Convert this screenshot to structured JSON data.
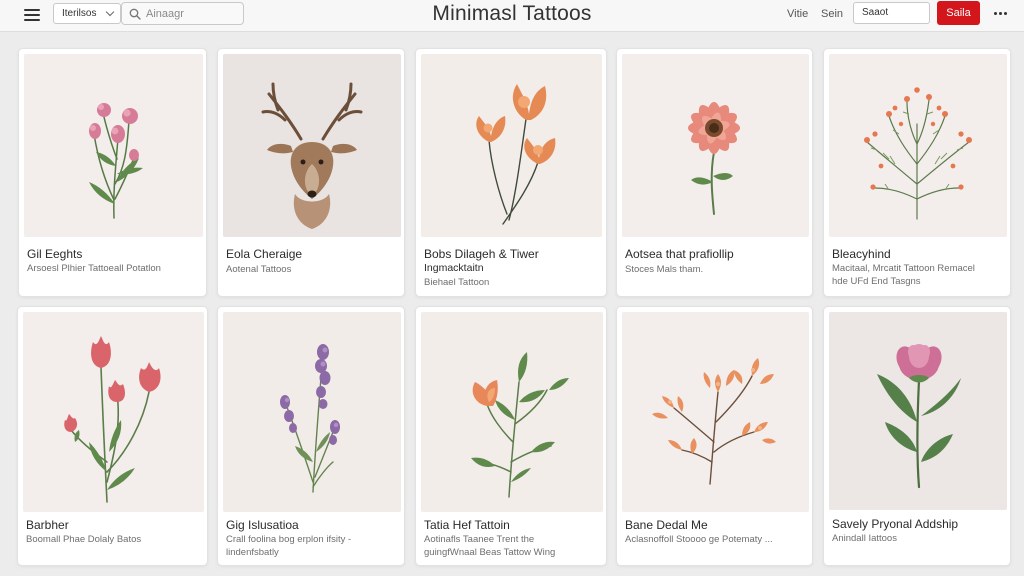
{
  "header": {
    "menu_icon": "hamburger-icon",
    "board_select": "Iterilsos",
    "search_icon": "search-icon",
    "search_placeholder": "Ainaagr",
    "title": "Minimasl Tattoos",
    "nav_link_1": "Vitie",
    "nav_link_2": "Sein",
    "sort_select": "Saaot",
    "cta_label": "Saila",
    "more_icon": "more-dots-icon",
    "accent_color": "#d3151c"
  },
  "cards": [
    {
      "title": "Gil Eeghts",
      "subtitle": [
        "Arsoesl Plhier Tattoeall Potatlon"
      ],
      "artwork": "pink-wildflowers-illustration"
    },
    {
      "title": "Eola Cheraige",
      "subtitle": [
        "Aotenal Tattoos"
      ],
      "artwork": "deer-antlers-illustration"
    },
    {
      "title": "Bobs Dilageh & Tiwer",
      "title_line2": "Ingmacktaitn",
      "subtitle": [
        "Biehael Tattoon"
      ],
      "artwork": "orange-poppies-illustration"
    },
    {
      "title": "Aotsea that prafiollip",
      "subtitle": [
        "Stoces Mals tham."
      ],
      "artwork": "coral-daisy-illustration"
    },
    {
      "title": "Bleacyhind",
      "subtitle": [
        "Macitaal, Mrcatit Tattoon Remacel",
        "hde UFd End Tasgns"
      ],
      "artwork": "orange-berry-sprig-illustration"
    },
    {
      "title": "Barbher",
      "subtitle": [
        "Boomall Phae Dolaly Batos"
      ],
      "artwork": "red-tulips-illustration"
    },
    {
      "title": "Gig Islusatioa",
      "subtitle": [
        "Crall foolina bog erplon ifsity -",
        "lindenfsbatly"
      ],
      "artwork": "lavender-illustration"
    },
    {
      "title": "Tatia Hef Tattoin",
      "subtitle": [
        "Aotinafls Taanee Trent the",
        "guingfWnaal Beas Tattow Wing"
      ],
      "artwork": "orange-bud-branch-illustration"
    },
    {
      "title": "Bane Dedal Me",
      "subtitle": [
        "Aclasnoffoll Stoooo ge Potematy ..."
      ],
      "artwork": "autumn-leaves-illustration"
    },
    {
      "title": "Savely Pryonal Addship",
      "subtitle": [
        "Anindall Iattoos"
      ],
      "artwork": "pink-peony-illustration"
    }
  ]
}
